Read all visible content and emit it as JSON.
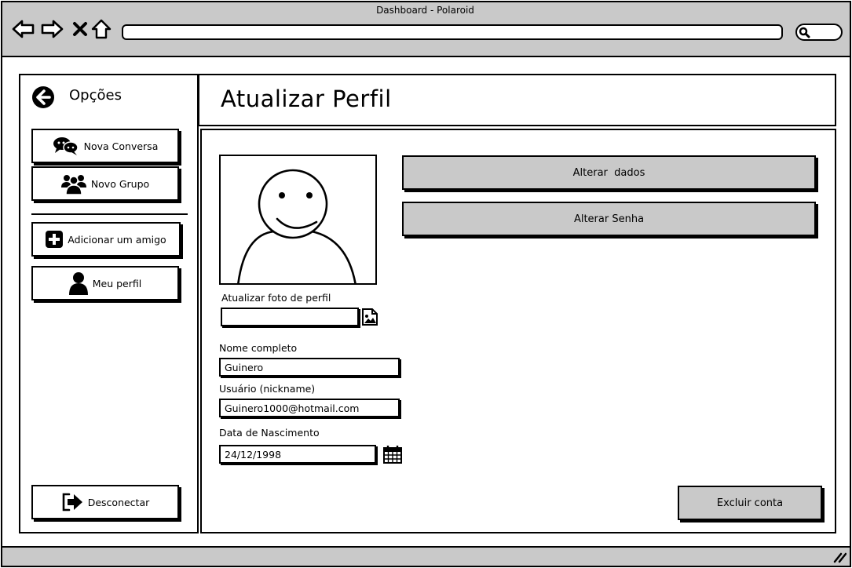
{
  "window": {
    "title": "Dashboard - Polaroid"
  },
  "browser": {
    "nav_icons": [
      "back-arrow-icon",
      "forward-arrow-icon",
      "close-x-icon",
      "home-icon"
    ],
    "url_value": "",
    "search_value": ""
  },
  "sidebar": {
    "title": "Opções",
    "back_icon": "arrow-left-circle-icon",
    "items": [
      {
        "label": "Nova Conversa",
        "icon": "chat-bubbles-icon"
      },
      {
        "label": "Novo Grupo",
        "icon": "group-icon"
      },
      {
        "label": "Adicionar um amigo",
        "icon": "plus-square-icon"
      },
      {
        "label": "Meu perfil",
        "icon": "user-icon"
      }
    ],
    "logout": {
      "label": "Desconectar",
      "icon": "sign-out-icon"
    }
  },
  "header": {
    "title": "Atualizar Perfil"
  },
  "profile": {
    "avatar": "avatar-placeholder-icon",
    "photo_label": "Atualizar foto de perfil",
    "photo_value": "",
    "photo_icon": "image-file-icon",
    "name_label": "Nome completo",
    "name_value": "Guinero",
    "username_label": "Usuário (nickname)",
    "username_value": "Guinero1000@hotmail.com",
    "birth_label": "Data de Nascimento",
    "birth_value": "24/12/1998",
    "calendar_icon": "calendar-icon"
  },
  "actions": {
    "update_data": "Alterar  dados",
    "change_password": "Alterar Senha",
    "delete_account": "Excluir conta"
  },
  "colors": {
    "chrome_gray": "#c9c9c9",
    "ink": "#000000",
    "paper": "#ffffff"
  }
}
